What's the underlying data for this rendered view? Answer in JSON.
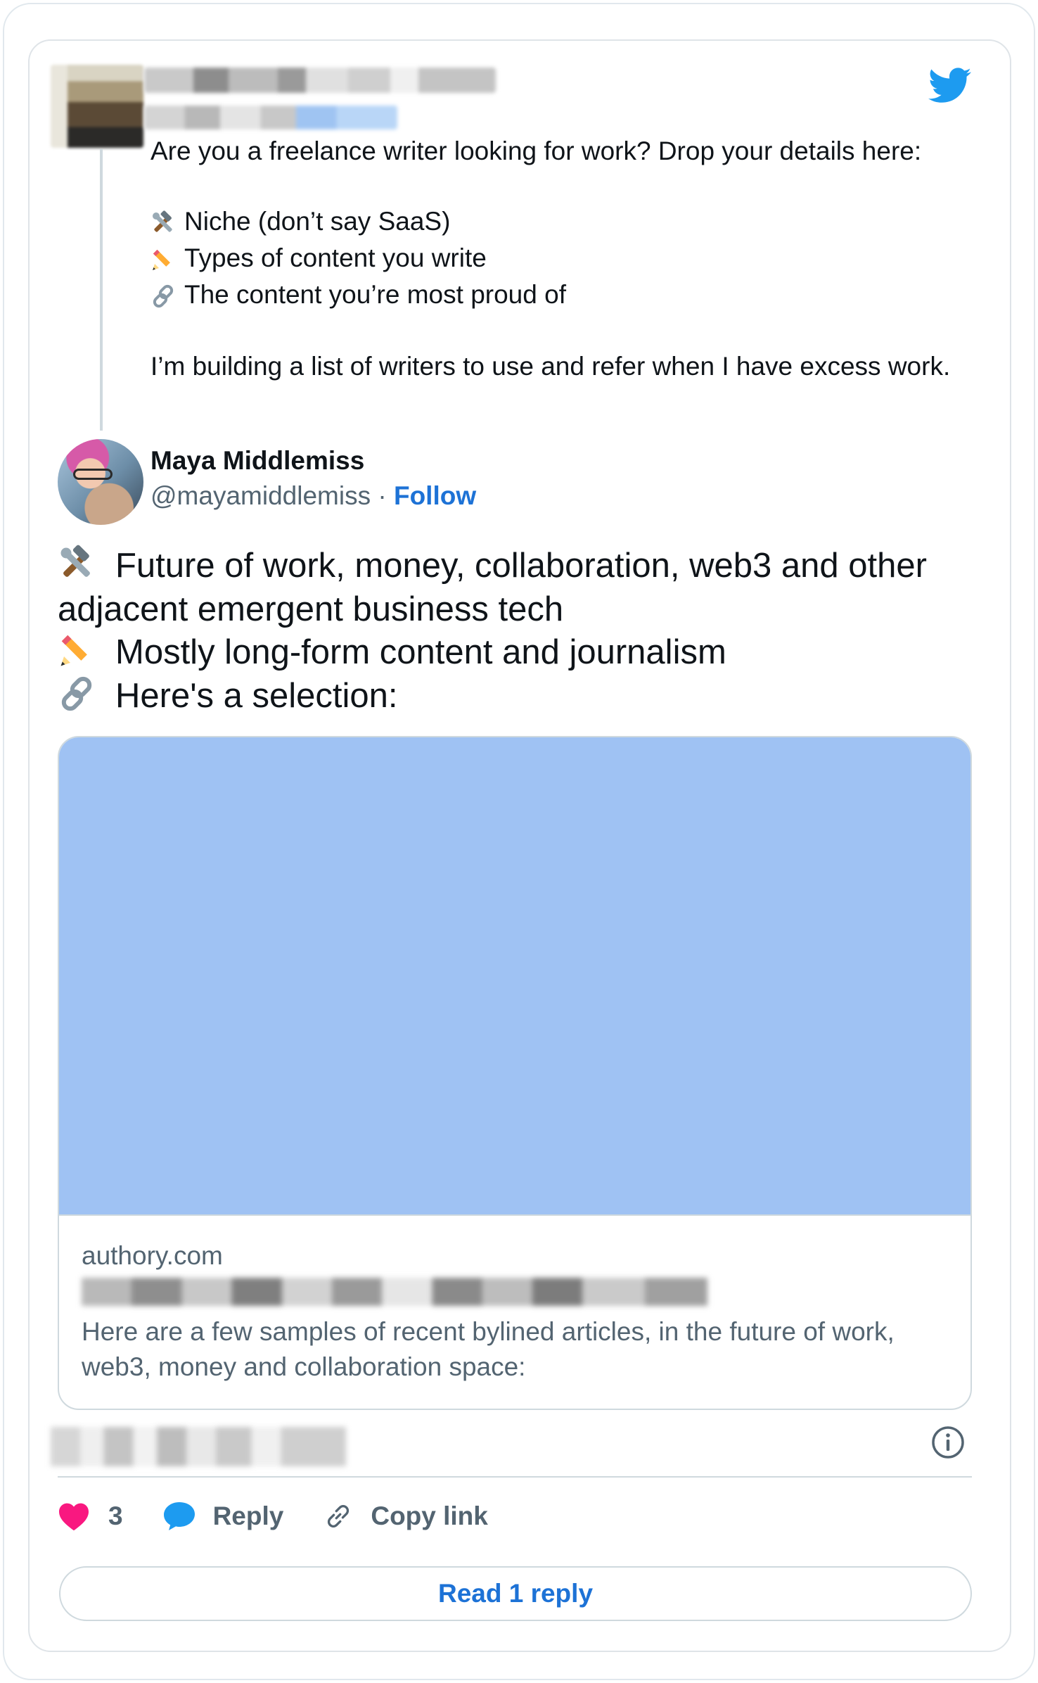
{
  "parent_tweet": {
    "line1": "Are you a freelance writer looking for work? Drop your details here:",
    "items": [
      {
        "icon": "hammer-and-wrench-icon",
        "text": "Niche (don’t say SaaS)"
      },
      {
        "icon": "pencil-icon",
        "text": "Types of content you write"
      },
      {
        "icon": "link-icon",
        "text": "The content you’re most proud of"
      }
    ],
    "closing": "I’m building a list of writers to use and refer when I have excess work."
  },
  "author": {
    "name": "Maya Middlemiss",
    "handle": "@mayamiddlemiss",
    "separator": "·",
    "follow_label": "Follow"
  },
  "tweet": {
    "lines": [
      {
        "icon": "hammer-and-wrench-icon",
        "text": "Future of work, money, collaboration, web3 and other adjacent emergent business tech"
      },
      {
        "icon": "pencil-icon",
        "text": "Mostly long-form content and journalism"
      },
      {
        "icon": "link-icon",
        "text": "Here's a selection:"
      }
    ]
  },
  "link_card": {
    "domain": "authory.com",
    "description": "Here are a few samples of recent bylined articles, in the future of work, web3, money and collaboration space:",
    "image_color": "#9fc2f3"
  },
  "actions": {
    "like_count": "3",
    "reply_label": "Reply",
    "copy_label": "Copy link",
    "read_reply_label": "Read 1 reply"
  },
  "colors": {
    "twitter_blue": "#1d9bf0",
    "link_blue": "#1d72d6",
    "like_red": "#f91880",
    "secondary_text": "#536471"
  }
}
